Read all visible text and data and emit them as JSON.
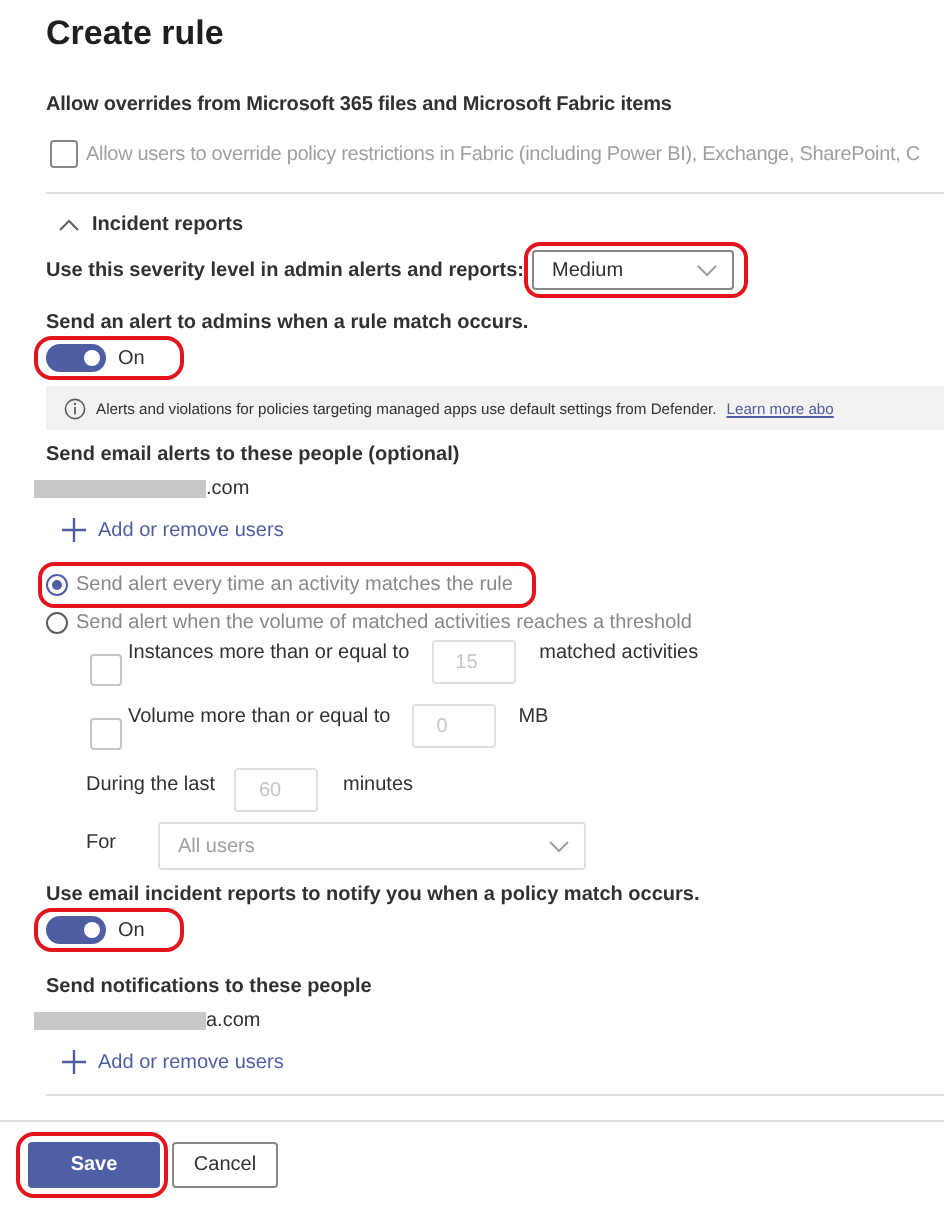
{
  "title": "Create rule",
  "overrides": {
    "heading": "Allow overrides from Microsoft 365 files and Microsoft Fabric items",
    "checkbox": {
      "label": "Allow users to override policy restrictions in Fabric (including Power BI), Exchange, SharePoint, C",
      "checked": false,
      "disabled": true
    }
  },
  "incident_reports": {
    "label": "Incident reports",
    "expanded": true,
    "severity": {
      "label": "Use this severity level in admin alerts and reports:",
      "value": "Medium",
      "highlighted": true
    },
    "admin_alert": {
      "label": "Send an alert to admins when a rule match occurs.",
      "toggle": {
        "on": true,
        "label": "On",
        "highlighted": true
      }
    },
    "info": {
      "text": "Alerts and violations for policies targeting managed apps use default settings from Defender.",
      "link": "Learn more abo"
    },
    "email_alerts": {
      "label": "Send email alerts to these people (optional)",
      "recipients": [
        ".com"
      ],
      "add_link": "Add or remove users"
    },
    "alert_modes": [
      {
        "label": "Send alert every time an activity matches the rule",
        "selected": true,
        "highlighted": true
      },
      {
        "label": "Send alert when the volume of matched activities reaches a threshold",
        "selected": false,
        "highlighted": false
      }
    ],
    "thresholds": [
      {
        "label": "Instances more than or equal to",
        "value": "15",
        "unit": "matched activities",
        "checked": false
      },
      {
        "label": "Volume more than or equal to",
        "value": "0",
        "unit": "MB",
        "checked": false
      }
    ],
    "during": {
      "label": "During the last",
      "value": "60",
      "unit": "minutes"
    },
    "for": {
      "label": "For",
      "value": "All users"
    },
    "incident_email": {
      "label": "Use email incident reports to notify you when a policy match occurs.",
      "toggle": {
        "on": true,
        "label": "On",
        "highlighted": true
      }
    },
    "notifications": {
      "label": "Send notifications to these people",
      "recipients": [
        "a.com"
      ],
      "add_link": "Add or remove users"
    }
  },
  "buttons": [
    {
      "label": "Save",
      "kind": "primary",
      "highlighted": true
    },
    {
      "label": "Cancel",
      "kind": "secondary",
      "highlighted": false
    }
  ]
}
